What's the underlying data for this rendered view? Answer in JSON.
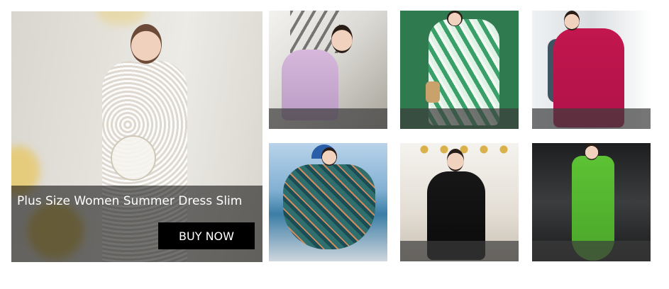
{
  "hero": {
    "title": "Plus Size Women Summer Dress Slim",
    "button_label": "BUY NOW",
    "button_color": "#000000",
    "overlay_color": "rgba(0,0,0,0.55)"
  },
  "thumbnails": [
    {
      "name": "lilac-lace-shorts-set"
    },
    {
      "name": "green-floral-maxi-dress"
    },
    {
      "name": "magenta-pleated-halter-dress"
    },
    {
      "name": "teal-print-chiffon-dress"
    },
    {
      "name": "black-sequin-mermaid-dress"
    },
    {
      "name": "green-slip-gown"
    }
  ]
}
